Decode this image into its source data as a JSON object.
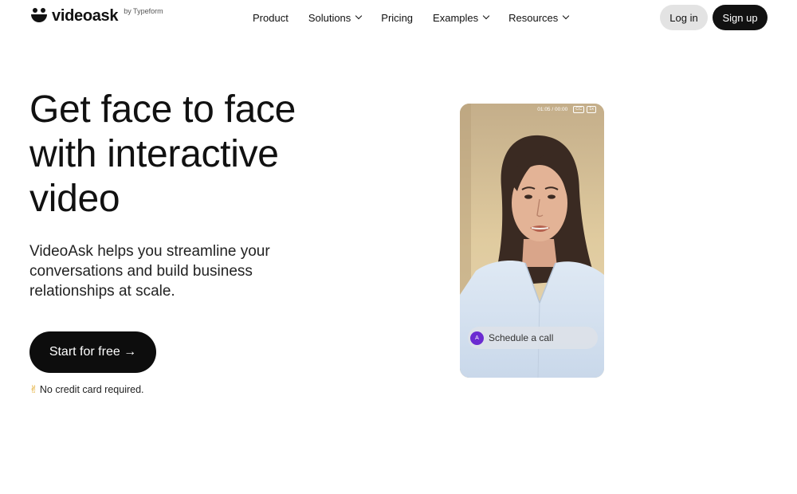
{
  "header": {
    "logo_text": "videoask",
    "logo_by": "by Typeform",
    "nav": [
      {
        "label": "Product",
        "dropdown": false
      },
      {
        "label": "Solutions",
        "dropdown": true
      },
      {
        "label": "Pricing",
        "dropdown": false
      },
      {
        "label": "Examples",
        "dropdown": true
      },
      {
        "label": "Resources",
        "dropdown": true
      }
    ],
    "login_label": "Log in",
    "signup_label": "Sign up"
  },
  "hero": {
    "title_lines": [
      "Get face to face",
      "with interactive",
      "video"
    ],
    "subtitle_lines": [
      "VideoAsk helps you streamline your",
      "conversations and build business",
      "relationships at scale."
    ],
    "cta_label": "Start for free →",
    "note_icon": "✌",
    "note_text": "No credit card required."
  },
  "video": {
    "time": "01:05 / 00:00",
    "cc_label": "CC",
    "speed_label": "1x",
    "avatar_letter": "A",
    "schedule_label": "Schedule a call"
  },
  "colors": {
    "primary": "#0d0d0d",
    "login_bg": "#e3e3e3",
    "avatar": "#6b2bd1"
  }
}
